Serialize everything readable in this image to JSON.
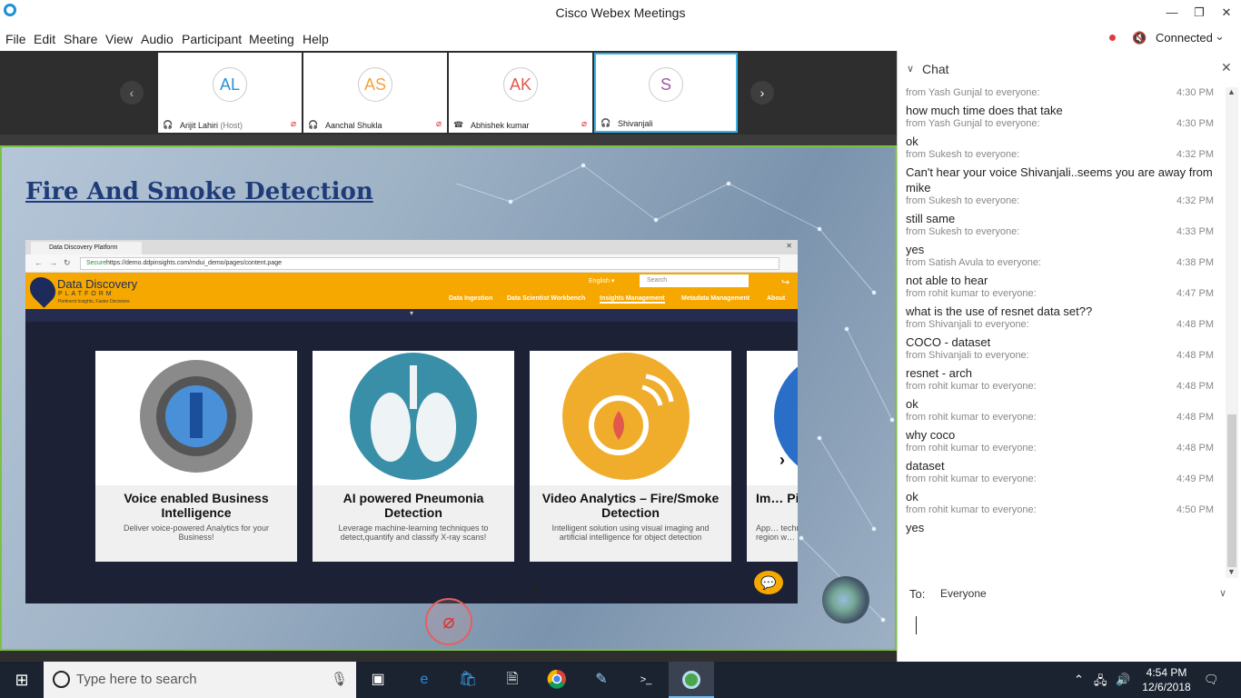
{
  "window": {
    "title": "Cisco Webex Meetings",
    "minimize": "—",
    "restore": "❐",
    "close": "✕"
  },
  "menu": [
    "File",
    "Edit",
    "Share",
    "View",
    "Audio",
    "Participant",
    "Meeting",
    "Help"
  ],
  "status": {
    "connected": "Connected"
  },
  "participants": [
    {
      "initials": "AL",
      "name": "Arijit Lahiri",
      "host": "(Host)",
      "color": "#2b8fd6",
      "muted": true,
      "audio": "headset"
    },
    {
      "initials": "AS",
      "name": "Aanchal Shukla",
      "host": "",
      "color": "#f2a33a",
      "muted": true,
      "audio": "headset"
    },
    {
      "initials": "AK",
      "name": "Abhishek kumar",
      "host": "",
      "color": "#e2584a",
      "muted": true,
      "audio": "phone"
    },
    {
      "initials": "S",
      "name": "Shivanjali",
      "host": "",
      "color": "#9c5aa5",
      "muted": false,
      "audio": "headset",
      "active": true
    }
  ],
  "slide": {
    "title": "Fire And Smoke Detection",
    "browser": {
      "tab_title": "Data Discovery Platform",
      "secure": "Secure",
      "url": "https://demo.ddpinsights.com/mdui_demo/pages/content.page"
    },
    "site": {
      "brand": "Data Discovery",
      "brand_sub": "PLATFORM",
      "tagline": "Pertinent Insights, Faster Decisions",
      "language": "English ▾",
      "search_placeholder": "Search",
      "nav": [
        "Data Ingestion",
        "Data Scientist Workbench",
        "Insights Management",
        "Metadata Management",
        "About"
      ],
      "active_nav": "Insights Management"
    },
    "cards": [
      {
        "title": "Voice enabled Business Intelligence",
        "desc": "Deliver voice-powered Analytics for your Business!",
        "color": "#555"
      },
      {
        "title": "AI powered Pneumonia Detection",
        "desc": "Leverage machine-learning techniques to detect,quantify and classify X-ray scans!",
        "color": "#3a8fa8"
      },
      {
        "title": "Video Analytics – Fire/Smoke Detection",
        "desc": "Intelligent solution using visual imaging and artificial intelligence for object detection",
        "color": "#f0ad2c"
      },
      {
        "title": "Im… Pipel…",
        "desc": "App… techniq… region w…",
        "color": "#2a6fc7"
      }
    ]
  },
  "chat": {
    "title": "Chat",
    "messages": [
      {
        "from": "from Yash Gunjal to everyone:",
        "time": "4:30 PM",
        "text": "how much time does that take"
      },
      {
        "from": "from Yash Gunjal to everyone:",
        "time": "4:30 PM",
        "text": "ok"
      },
      {
        "from": "from Sukesh to everyone:",
        "time": "4:32 PM",
        "text": "Can't hear your voice Shivanjali..seems you are away from mike"
      },
      {
        "from": "from Sukesh to everyone:",
        "time": "4:32 PM",
        "text": "still same"
      },
      {
        "from": "from Sukesh to everyone:",
        "time": "4:33 PM",
        "text": "yes"
      },
      {
        "from": "from Satish Avula to everyone:",
        "time": "4:38 PM",
        "text": "not able to hear"
      },
      {
        "from": "from rohit kumar to everyone:",
        "time": "4:47 PM",
        "text": "what is the use of resnet data  set??"
      },
      {
        "from": "from Shivanjali to everyone:",
        "time": "4:48 PM",
        "text": "COCO - dataset"
      },
      {
        "from": "from Shivanjali to everyone:",
        "time": "4:48 PM",
        "text": "resnet - arch"
      },
      {
        "from": "from rohit kumar to everyone:",
        "time": "4:48 PM",
        "text": "ok"
      },
      {
        "from": "from rohit kumar to everyone:",
        "time": "4:48 PM",
        "text": "why coco"
      },
      {
        "from": "from rohit kumar to everyone:",
        "time": "4:48 PM",
        "text": "dataset"
      },
      {
        "from": "from rohit kumar to everyone:",
        "time": "4:49 PM",
        "text": "ok"
      },
      {
        "from": "from rohit kumar to everyone:",
        "time": "4:50 PM",
        "text": "yes"
      }
    ],
    "to_label": "To:",
    "to_value": "Everyone",
    "input_value": ""
  },
  "taskbar": {
    "search_placeholder": "Type here to search",
    "time": "4:54 PM",
    "date": "12/6/2018"
  }
}
